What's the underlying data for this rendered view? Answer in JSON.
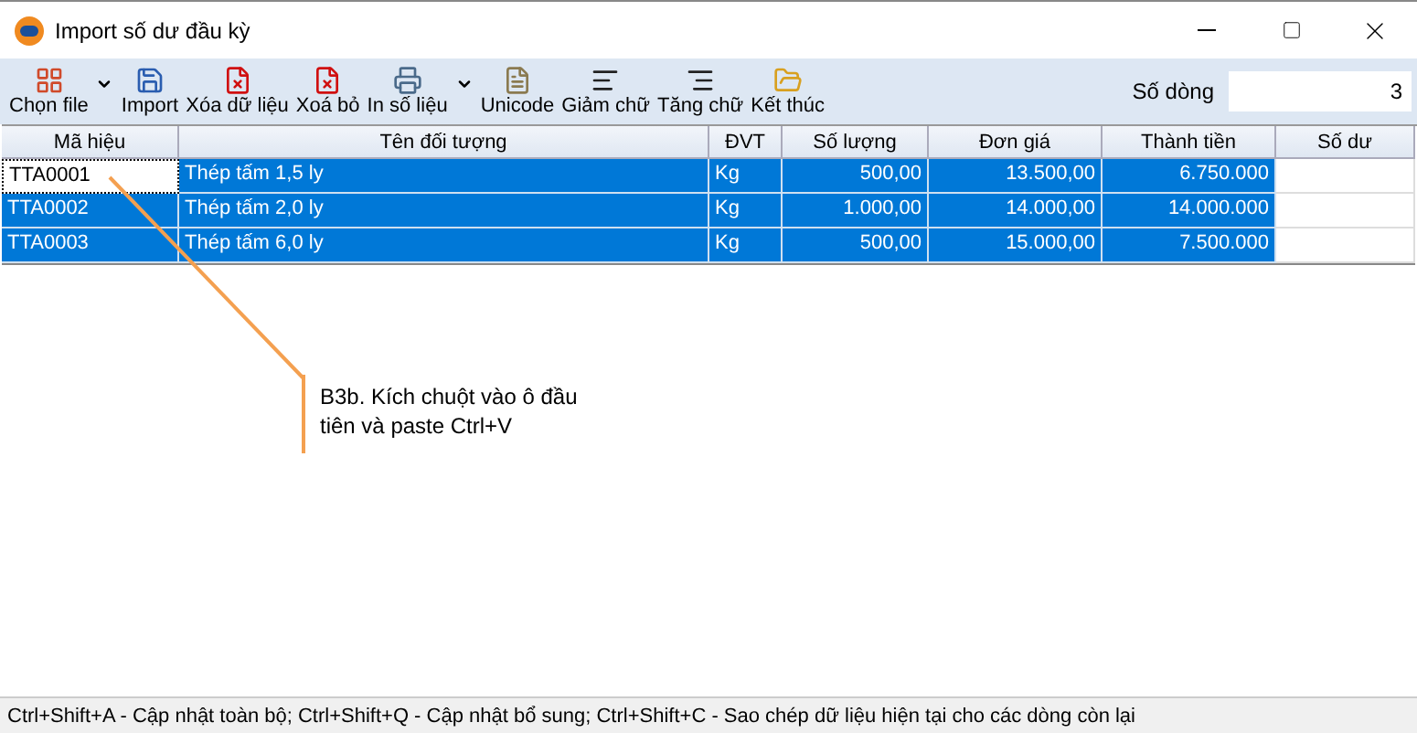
{
  "window": {
    "title": "Import số dư đầu kỳ"
  },
  "toolbar": [
    {
      "label": "Chọn file",
      "kind": "dropdown"
    },
    {
      "label": "Import",
      "kind": "button"
    },
    {
      "label": "Xóa dữ liệu",
      "kind": "button"
    },
    {
      "label": "Xoá bỏ",
      "kind": "button"
    },
    {
      "label": "In số liệu",
      "kind": "dropdown"
    },
    {
      "label": "Unicode",
      "kind": "button"
    },
    {
      "label": "Giảm chữ",
      "kind": "button"
    },
    {
      "label": "Tăng chữ",
      "kind": "button"
    },
    {
      "label": "Kết thúc",
      "kind": "button"
    }
  ],
  "row_count": {
    "label": "Số dòng",
    "value": "3"
  },
  "table": {
    "columns": [
      "Mã hiệu",
      "Tên đối tượng",
      "ĐVT",
      "Số lượng",
      "Đơn giá",
      "Thành tiền",
      "Số dư"
    ],
    "rows": [
      {
        "selected": true,
        "focused": true,
        "cells": [
          "TTA0001",
          "Thép tấm 1,5 ly",
          "Kg",
          "500,00",
          "13.500,00",
          "6.750.000",
          ""
        ]
      },
      {
        "selected": true,
        "focused": false,
        "cells": [
          "TTA0002",
          "Thép tấm 2,0 ly",
          "Kg",
          "1.000,00",
          "14.000,00",
          "14.000.000",
          ""
        ]
      },
      {
        "selected": true,
        "focused": false,
        "cells": [
          "TTA0003",
          "Thép tấm 6,0 ly",
          "Kg",
          "500,00",
          "15.000,00",
          "7.500.000",
          ""
        ]
      }
    ]
  },
  "annotation": "B3b. Kích chuột vào ô đầu tiên và paste Ctrl+V",
  "status_bar": "Ctrl+Shift+A - Cập nhật toàn bộ; Ctrl+Shift+Q - Cập nhật bổ sung; Ctrl+Shift+C - Sao chép dữ liệu hiện tại cho các dòng còn lại"
}
